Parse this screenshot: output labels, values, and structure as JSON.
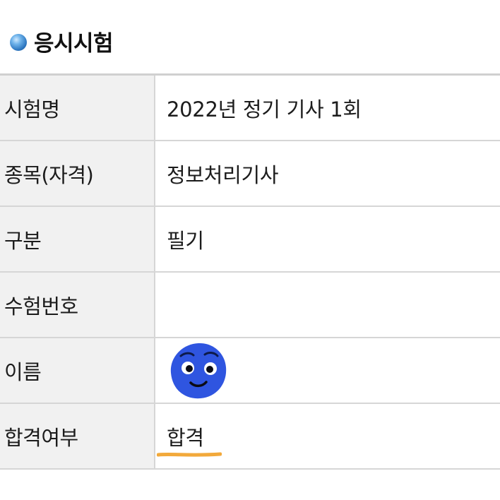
{
  "section": {
    "title": "응시시험",
    "bullet_color": "#2c76c0"
  },
  "rows": [
    {
      "label": "시험명",
      "value": "2022년 정기 기사 1회"
    },
    {
      "label": "종목(자격)",
      "value": "정보처리기사"
    },
    {
      "label": "구분",
      "value": "필기"
    },
    {
      "label": "수험번호",
      "value": ""
    },
    {
      "label": "이름",
      "value": "",
      "avatar_icon": "blue-smiley-face-icon"
    },
    {
      "label": "합격여부",
      "value": "합격",
      "highlight_color": "#f2a93b"
    }
  ],
  "colors": {
    "label_background": "#f1f1f1",
    "border": "#d6d6d6",
    "avatar_blue": "#2f55e0"
  }
}
